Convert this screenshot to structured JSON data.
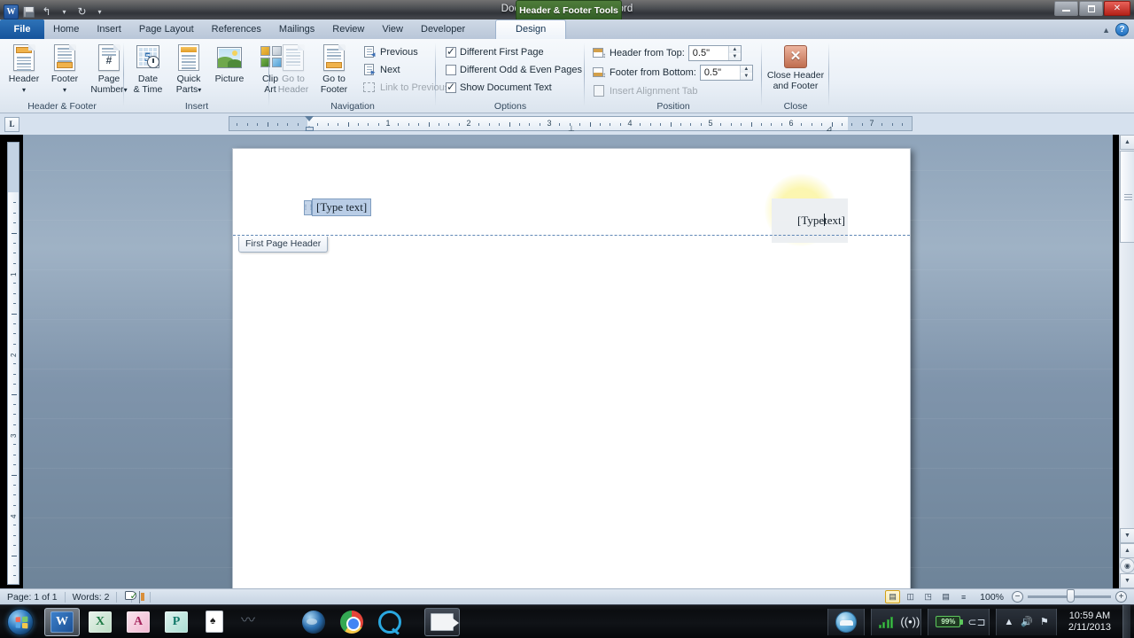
{
  "window": {
    "title": "Document1  -  Microsoft Word",
    "quick_access": [
      "word-logo",
      "save-icon",
      "undo-icon",
      "redo-icon",
      "customize-icon"
    ],
    "controls": {
      "minimize": "—",
      "restore": "❐",
      "close": "✕"
    },
    "help_label": "?",
    "collapse_ribbon": "▲"
  },
  "context_tab_banner": "Header & Footer Tools",
  "tabs": [
    {
      "label": "File",
      "state": "file"
    },
    {
      "label": "Home",
      "state": "normal"
    },
    {
      "label": "Insert",
      "state": "normal"
    },
    {
      "label": "Page Layout",
      "state": "normal"
    },
    {
      "label": "References",
      "state": "normal"
    },
    {
      "label": "Mailings",
      "state": "normal"
    },
    {
      "label": "Review",
      "state": "normal"
    },
    {
      "label": "View",
      "state": "normal"
    },
    {
      "label": "Developer",
      "state": "normal"
    },
    {
      "label": "Design",
      "state": "active"
    }
  ],
  "ribbon": {
    "groups": [
      {
        "name": "Header & Footer",
        "label": "Header & Footer",
        "buttons": [
          {
            "label": "Header",
            "dropdown": "▾",
            "icon": "header-icon"
          },
          {
            "label": "Footer",
            "dropdown": "▾",
            "icon": "footer-icon"
          },
          {
            "label": "Page",
            "label2": "Number",
            "dropdown": "▾",
            "icon": "page-number-icon"
          }
        ]
      },
      {
        "name": "Insert",
        "label": "Insert",
        "buttons": [
          {
            "label": "Date",
            "label2": "& Time",
            "icon": "date-time-icon"
          },
          {
            "label": "Quick",
            "label2": "Parts",
            "dropdown": "▾",
            "icon": "quick-parts-icon"
          },
          {
            "label": "Picture",
            "icon": "picture-icon"
          },
          {
            "label": "Clip",
            "label2": "Art",
            "icon": "clip-art-icon"
          }
        ]
      },
      {
        "name": "Navigation",
        "label": "Navigation",
        "buttons": [
          {
            "label": "Go to",
            "label2": "Header",
            "icon": "go-to-header-icon",
            "disabled": true
          },
          {
            "label": "Go to",
            "label2": "Footer",
            "icon": "go-to-footer-icon",
            "disabled": false
          }
        ],
        "commands": [
          {
            "label": "Previous",
            "icon": "previous-icon",
            "disabled": false
          },
          {
            "label": "Next",
            "icon": "next-icon",
            "disabled": false
          },
          {
            "label": "Link to Previous",
            "icon": "link-to-previous-icon",
            "disabled": true
          }
        ]
      },
      {
        "name": "Options",
        "label": "Options",
        "checkboxes": [
          {
            "label": "Different First Page",
            "checked": true
          },
          {
            "label": "Different Odd & Even Pages",
            "checked": false
          },
          {
            "label": "Show Document Text",
            "checked": true
          }
        ]
      },
      {
        "name": "Position",
        "label": "Position",
        "fields": [
          {
            "label": "Header from Top:",
            "value": "0.5\"",
            "icon": "header-from-top-icon"
          },
          {
            "label": "Footer from Bottom:",
            "value": "0.5\"",
            "icon": "footer-from-bottom-icon"
          }
        ],
        "commands": [
          {
            "label": "Insert Alignment Tab",
            "icon": "insert-alignment-tab-icon",
            "disabled": true
          }
        ]
      },
      {
        "name": "Close",
        "label": "Close",
        "buttons": [
          {
            "label": "Close Header",
            "label2": "and Footer",
            "icon": "close-header-footer-icon"
          }
        ]
      }
    ]
  },
  "rulers": {
    "tab_selector": "L",
    "horizontal_numbers": [
      "1",
      "2",
      "3",
      "4",
      "5",
      "6",
      "7"
    ],
    "vertical_numbers": [
      "1",
      "2",
      "3",
      "4"
    ]
  },
  "document": {
    "header_left_text": "[Type text]",
    "header_right_before_caret": "[Type",
    "header_right_after_caret": "text]",
    "header_tag": "First Page Header"
  },
  "status_bar": {
    "page": "Page: 1 of 1",
    "words": "Words: 2",
    "proofing_icon": "proofing-errors-icon",
    "language_icon": "document-views-icon",
    "view_buttons": [
      {
        "name": "print-layout",
        "glyph": "▤",
        "selected": true
      },
      {
        "name": "full-screen-reading",
        "glyph": "◫",
        "selected": false
      },
      {
        "name": "web-layout",
        "glyph": "◳",
        "selected": false
      },
      {
        "name": "outline",
        "glyph": "▤",
        "selected": false
      },
      {
        "name": "draft",
        "glyph": "≡",
        "selected": false
      }
    ],
    "zoom_level": "100%",
    "zoom_out": "−",
    "zoom_in": "+"
  },
  "taskbar": {
    "start_label": "Start",
    "items": [
      {
        "name": "word",
        "glyph": "W",
        "state": "active"
      },
      {
        "name": "excel",
        "glyph": "X",
        "state": "normal"
      },
      {
        "name": "access",
        "glyph": "A",
        "state": "normal"
      },
      {
        "name": "powerpoint",
        "glyph": "P",
        "state": "normal"
      },
      {
        "name": "solitaire",
        "glyph": "♠",
        "state": "normal"
      },
      {
        "name": "scribble",
        "glyph": "〰",
        "state": "normal"
      },
      {
        "name": "google-earth",
        "glyph": "",
        "state": "normal"
      },
      {
        "name": "chrome",
        "glyph": "",
        "state": "normal"
      },
      {
        "name": "quicktime",
        "glyph": "",
        "state": "normal"
      },
      {
        "name": "video-recorder",
        "glyph": "",
        "state": "sel2"
      }
    ],
    "tray": {
      "network_signal": "signal-bars-icon",
      "wireless": "wireless-icon",
      "battery_percent": "99%",
      "power_plug": "power-plug-icon",
      "show_hidden": "▲",
      "volume": "volume-icon",
      "action_center": "flag-icon",
      "time": "10:59 AM",
      "date": "2/11/2013"
    }
  }
}
